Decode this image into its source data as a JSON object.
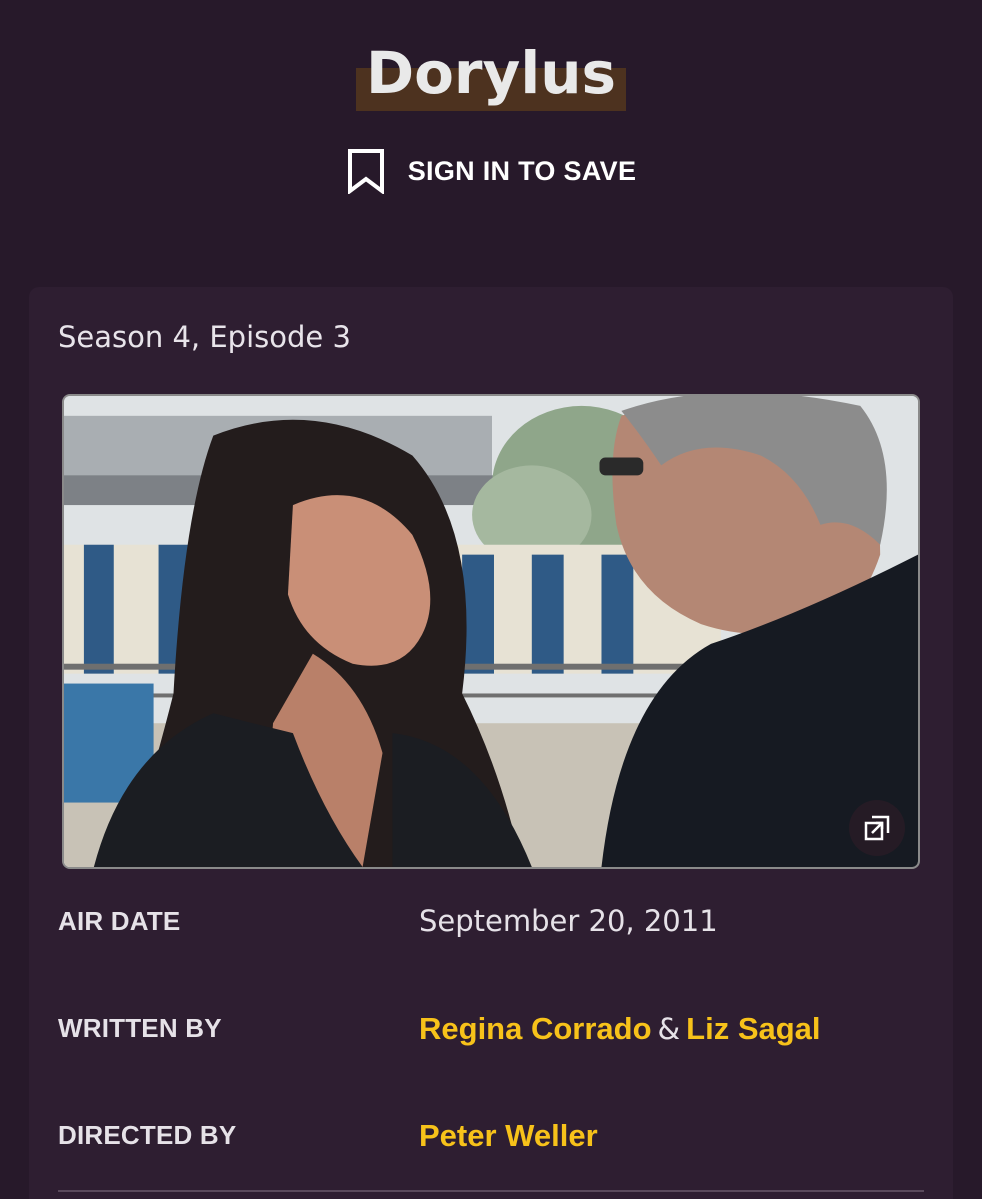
{
  "episode": {
    "title": "Dorylus",
    "save_label": "SIGN IN TO SAVE",
    "season_episode": "Season 4, Episode 3"
  },
  "details": {
    "air_date_label": "AIR DATE",
    "air_date": "September 20, 2011",
    "written_by_label": "WRITTEN BY",
    "writer_1": "Regina Corrado",
    "writers_separator": "&",
    "writer_2": "Liz Sagal",
    "directed_by_label": "DIRECTED BY",
    "director": "Peter Weller"
  },
  "icons": {
    "bookmark": "bookmark-icon",
    "expand": "expand-icon"
  },
  "colors": {
    "background": "#27192a",
    "card": "#2e1e31",
    "link": "#f7c21a",
    "title_highlight": "#4d321f"
  }
}
